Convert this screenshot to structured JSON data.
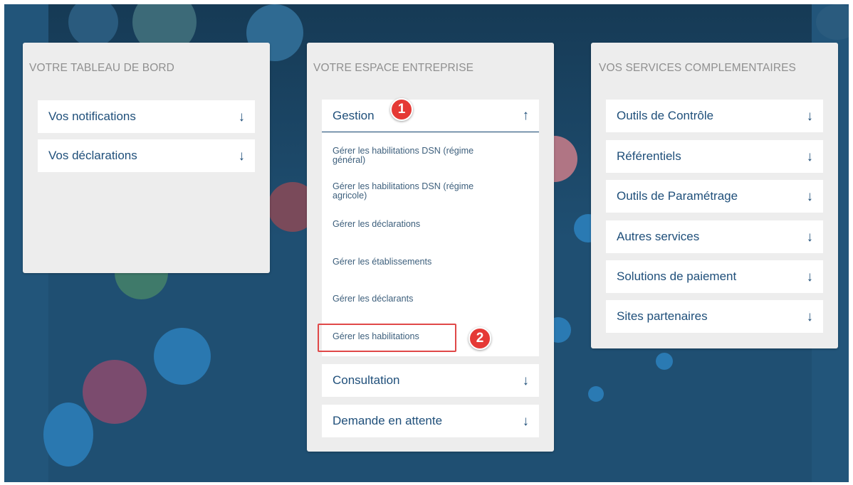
{
  "panels": {
    "dashboard": {
      "title": "VOTRE TABLEAU DE BORD",
      "items": [
        {
          "label": "Vos notifications",
          "arrow": "↓"
        },
        {
          "label": "Vos déclarations",
          "arrow": "↓"
        }
      ]
    },
    "enterprise": {
      "title": "VOTRE ESPACE ENTREPRISE",
      "gestion": {
        "label": "Gestion",
        "arrow": "↑"
      },
      "gestion_links": [
        "Gérer les habilitations DSN (régime général)",
        "Gérer les habilitations DSN (régime agricole)",
        "Gérer les déclarations",
        "Gérer les établissements",
        "Gérer les déclarants",
        "Gérer les habilitations"
      ],
      "items": [
        {
          "label": "Consultation",
          "arrow": "↓"
        },
        {
          "label": "Demande en attente",
          "arrow": "↓"
        }
      ]
    },
    "services": {
      "title": "VOS SERVICES COMPLEMENTAIRES",
      "items": [
        {
          "label": "Outils de Contrôle",
          "arrow": "↓"
        },
        {
          "label": "Référentiels",
          "arrow": "↓"
        },
        {
          "label": "Outils de Paramétrage",
          "arrow": "↓"
        },
        {
          "label": "Autres services",
          "arrow": "↓"
        },
        {
          "label": "Solutions de paiement",
          "arrow": "↓"
        },
        {
          "label": "Sites partenaires",
          "arrow": "↓"
        }
      ]
    }
  },
  "annotations": {
    "step1": "1",
    "step2": "2"
  },
  "colors": {
    "link": "#1f4f7a",
    "background": "#1f4f72",
    "highlight": "#e53935"
  }
}
